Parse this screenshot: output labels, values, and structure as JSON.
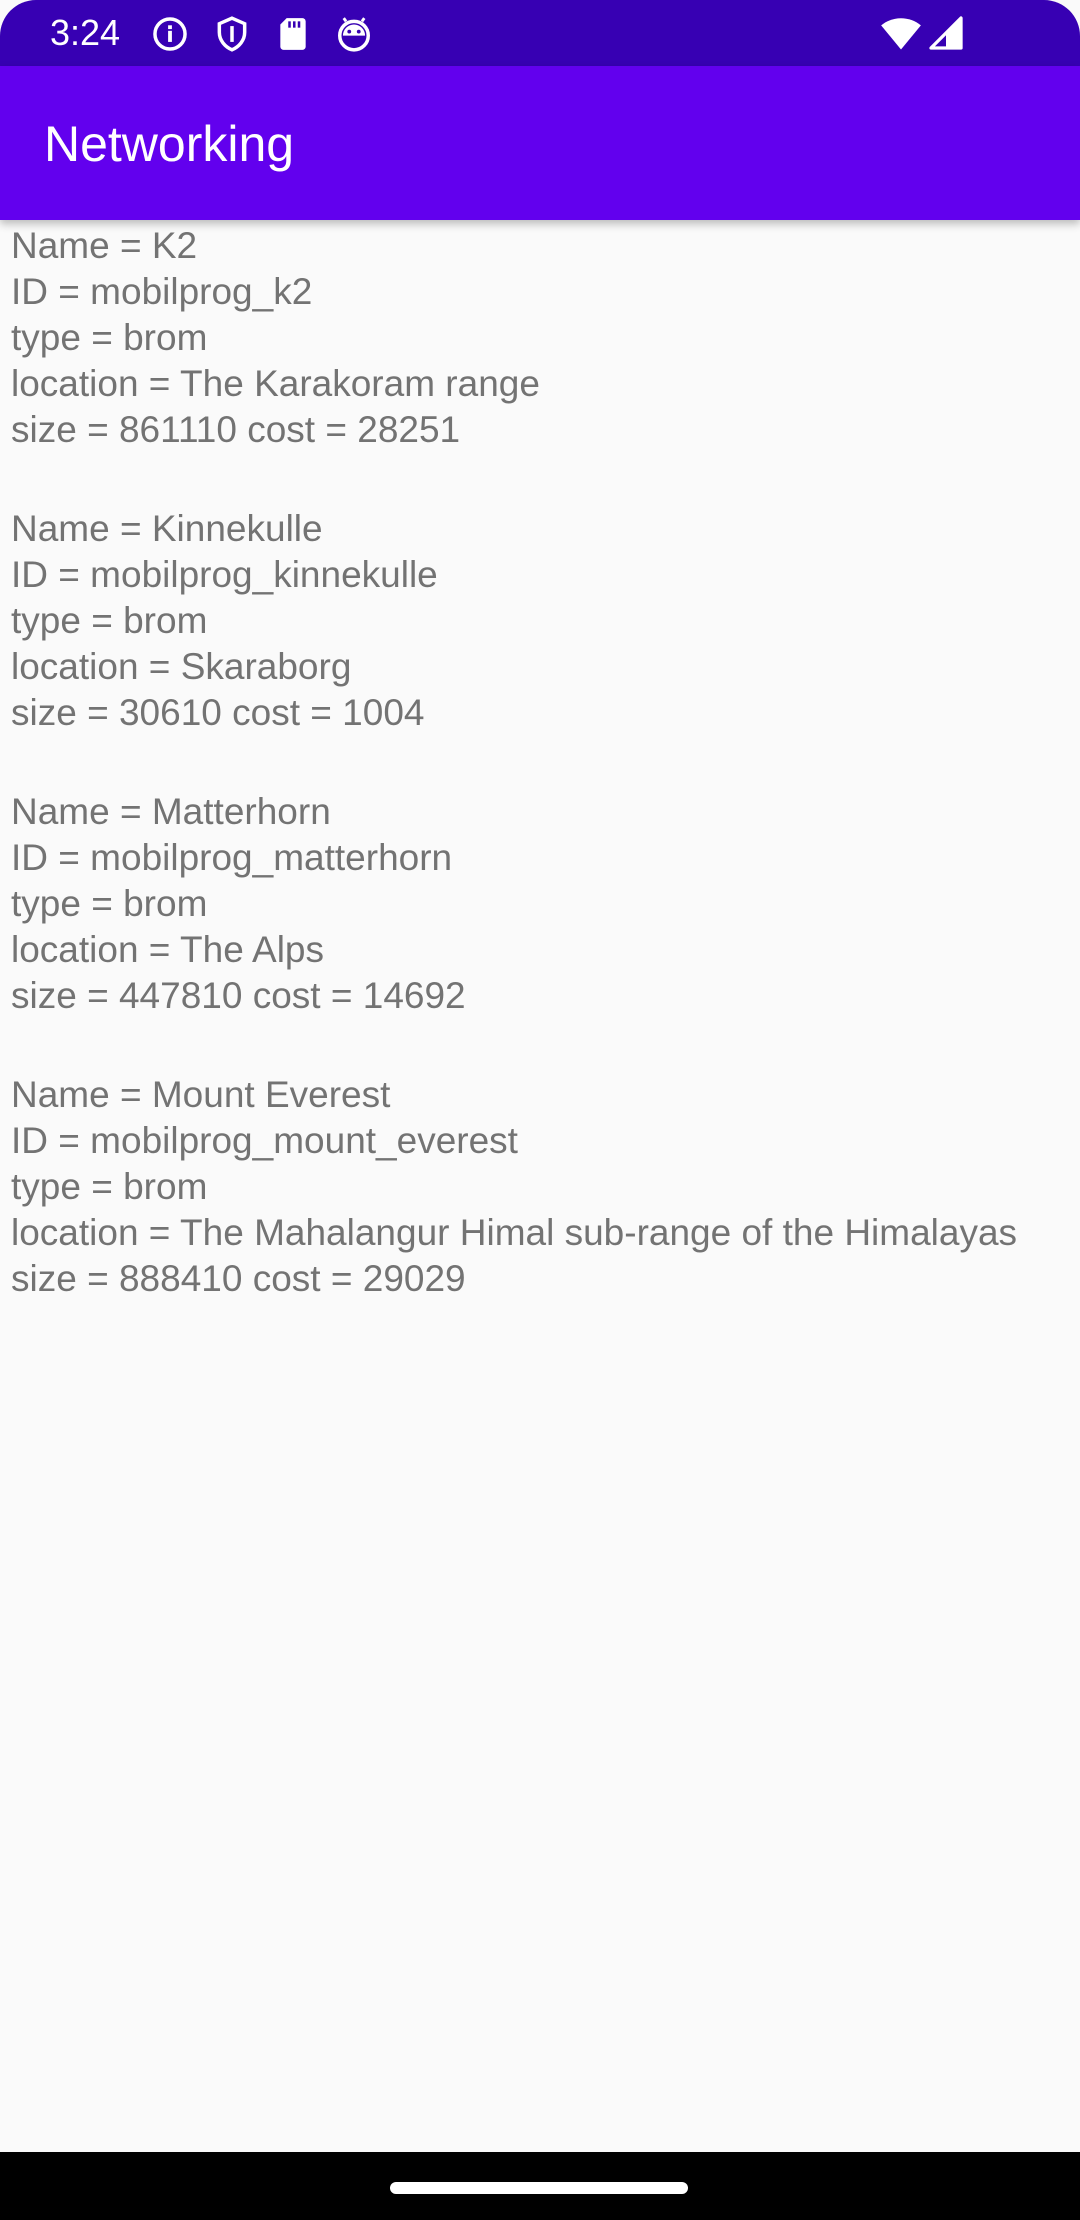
{
  "status_bar": {
    "time": "3:24",
    "icons_left": [
      "info-icon",
      "shield-icon",
      "sd-card-icon",
      "android-head-icon"
    ],
    "icons_right": [
      "wifi-icon",
      "signal-icon"
    ]
  },
  "app_bar": {
    "title": "Networking",
    "color": "#6200ee",
    "status_color": "#3700b3"
  },
  "entries": [
    {
      "name_line": "Name = K2",
      "id_line": "ID = mobilprog_k2",
      "type_line": "type = brom",
      "location_line": "location = The Karakoram range",
      "size_cost_line": "size = 861110 cost = 28251"
    },
    {
      "name_line": "Name = Kinnekulle",
      "id_line": "ID = mobilprog_kinnekulle",
      "type_line": "type = brom",
      "location_line": "location = Skaraborg",
      "size_cost_line": "size = 30610 cost = 1004"
    },
    {
      "name_line": "Name = Matterhorn",
      "id_line": "ID = mobilprog_matterhorn",
      "type_line": "type = brom",
      "location_line": "location = The Alps",
      "size_cost_line": "size = 447810 cost = 14692"
    },
    {
      "name_line": "Name = Mount Everest",
      "id_line": "ID = mobilprog_mount_everest",
      "type_line": "type = brom",
      "location_line": "location = The Mahalangur Himal sub-range of the Himalayas",
      "size_cost_line": "size = 888410 cost = 29029"
    }
  ]
}
